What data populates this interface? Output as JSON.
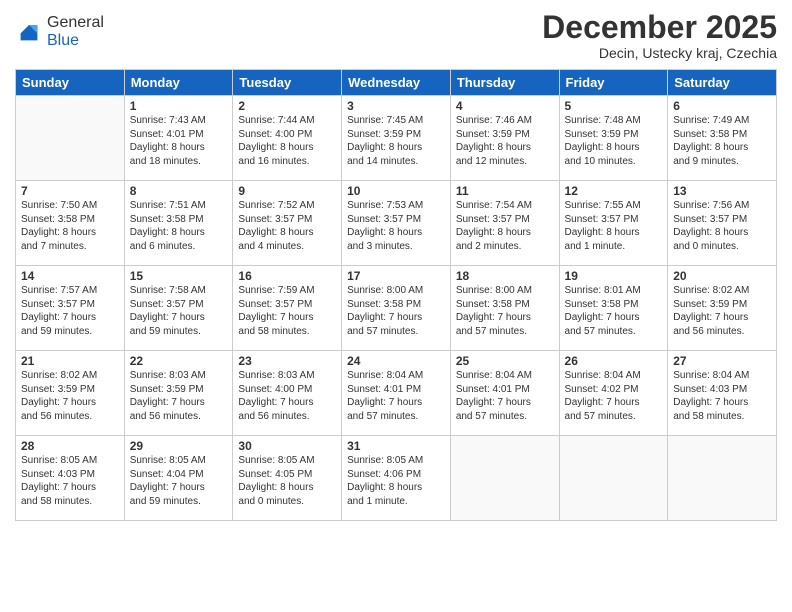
{
  "header": {
    "logo_line1": "General",
    "logo_line2": "Blue",
    "month_title": "December 2025",
    "location": "Decin, Ustecky kraj, Czechia"
  },
  "weekdays": [
    "Sunday",
    "Monday",
    "Tuesday",
    "Wednesday",
    "Thursday",
    "Friday",
    "Saturday"
  ],
  "weeks": [
    [
      {
        "day": "",
        "content": ""
      },
      {
        "day": "1",
        "content": "Sunrise: 7:43 AM\nSunset: 4:01 PM\nDaylight: 8 hours\nand 18 minutes."
      },
      {
        "day": "2",
        "content": "Sunrise: 7:44 AM\nSunset: 4:00 PM\nDaylight: 8 hours\nand 16 minutes."
      },
      {
        "day": "3",
        "content": "Sunrise: 7:45 AM\nSunset: 3:59 PM\nDaylight: 8 hours\nand 14 minutes."
      },
      {
        "day": "4",
        "content": "Sunrise: 7:46 AM\nSunset: 3:59 PM\nDaylight: 8 hours\nand 12 minutes."
      },
      {
        "day": "5",
        "content": "Sunrise: 7:48 AM\nSunset: 3:59 PM\nDaylight: 8 hours\nand 10 minutes."
      },
      {
        "day": "6",
        "content": "Sunrise: 7:49 AM\nSunset: 3:58 PM\nDaylight: 8 hours\nand 9 minutes."
      }
    ],
    [
      {
        "day": "7",
        "content": "Sunrise: 7:50 AM\nSunset: 3:58 PM\nDaylight: 8 hours\nand 7 minutes."
      },
      {
        "day": "8",
        "content": "Sunrise: 7:51 AM\nSunset: 3:58 PM\nDaylight: 8 hours\nand 6 minutes."
      },
      {
        "day": "9",
        "content": "Sunrise: 7:52 AM\nSunset: 3:57 PM\nDaylight: 8 hours\nand 4 minutes."
      },
      {
        "day": "10",
        "content": "Sunrise: 7:53 AM\nSunset: 3:57 PM\nDaylight: 8 hours\nand 3 minutes."
      },
      {
        "day": "11",
        "content": "Sunrise: 7:54 AM\nSunset: 3:57 PM\nDaylight: 8 hours\nand 2 minutes."
      },
      {
        "day": "12",
        "content": "Sunrise: 7:55 AM\nSunset: 3:57 PM\nDaylight: 8 hours\nand 1 minute."
      },
      {
        "day": "13",
        "content": "Sunrise: 7:56 AM\nSunset: 3:57 PM\nDaylight: 8 hours\nand 0 minutes."
      }
    ],
    [
      {
        "day": "14",
        "content": "Sunrise: 7:57 AM\nSunset: 3:57 PM\nDaylight: 7 hours\nand 59 minutes."
      },
      {
        "day": "15",
        "content": "Sunrise: 7:58 AM\nSunset: 3:57 PM\nDaylight: 7 hours\nand 59 minutes."
      },
      {
        "day": "16",
        "content": "Sunrise: 7:59 AM\nSunset: 3:57 PM\nDaylight: 7 hours\nand 58 minutes."
      },
      {
        "day": "17",
        "content": "Sunrise: 8:00 AM\nSunset: 3:58 PM\nDaylight: 7 hours\nand 57 minutes."
      },
      {
        "day": "18",
        "content": "Sunrise: 8:00 AM\nSunset: 3:58 PM\nDaylight: 7 hours\nand 57 minutes."
      },
      {
        "day": "19",
        "content": "Sunrise: 8:01 AM\nSunset: 3:58 PM\nDaylight: 7 hours\nand 57 minutes."
      },
      {
        "day": "20",
        "content": "Sunrise: 8:02 AM\nSunset: 3:59 PM\nDaylight: 7 hours\nand 56 minutes."
      }
    ],
    [
      {
        "day": "21",
        "content": "Sunrise: 8:02 AM\nSunset: 3:59 PM\nDaylight: 7 hours\nand 56 minutes."
      },
      {
        "day": "22",
        "content": "Sunrise: 8:03 AM\nSunset: 3:59 PM\nDaylight: 7 hours\nand 56 minutes."
      },
      {
        "day": "23",
        "content": "Sunrise: 8:03 AM\nSunset: 4:00 PM\nDaylight: 7 hours\nand 56 minutes."
      },
      {
        "day": "24",
        "content": "Sunrise: 8:04 AM\nSunset: 4:01 PM\nDaylight: 7 hours\nand 57 minutes."
      },
      {
        "day": "25",
        "content": "Sunrise: 8:04 AM\nSunset: 4:01 PM\nDaylight: 7 hours\nand 57 minutes."
      },
      {
        "day": "26",
        "content": "Sunrise: 8:04 AM\nSunset: 4:02 PM\nDaylight: 7 hours\nand 57 minutes."
      },
      {
        "day": "27",
        "content": "Sunrise: 8:04 AM\nSunset: 4:03 PM\nDaylight: 7 hours\nand 58 minutes."
      }
    ],
    [
      {
        "day": "28",
        "content": "Sunrise: 8:05 AM\nSunset: 4:03 PM\nDaylight: 7 hours\nand 58 minutes."
      },
      {
        "day": "29",
        "content": "Sunrise: 8:05 AM\nSunset: 4:04 PM\nDaylight: 7 hours\nand 59 minutes."
      },
      {
        "day": "30",
        "content": "Sunrise: 8:05 AM\nSunset: 4:05 PM\nDaylight: 8 hours\nand 0 minutes."
      },
      {
        "day": "31",
        "content": "Sunrise: 8:05 AM\nSunset: 4:06 PM\nDaylight: 8 hours\nand 1 minute."
      },
      {
        "day": "",
        "content": ""
      },
      {
        "day": "",
        "content": ""
      },
      {
        "day": "",
        "content": ""
      }
    ]
  ]
}
